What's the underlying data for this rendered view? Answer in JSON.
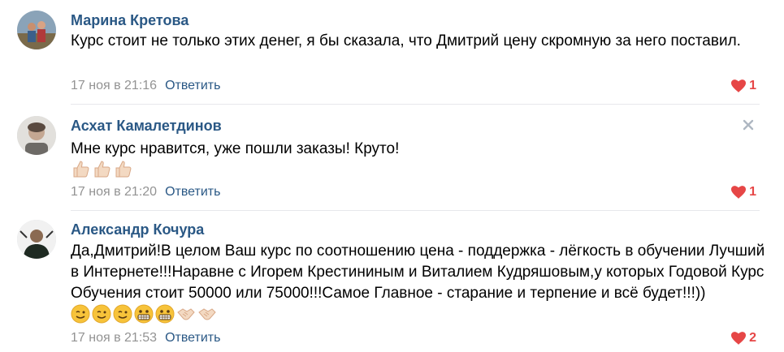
{
  "comments": [
    {
      "author": "Марина Кретова",
      "text": "Курс стоит не только этих денег, я бы сказала, что Дмитрий цену скромную за него поставил.",
      "date": "17 ноя в 21:16",
      "reply_label": "Ответить",
      "likes": "1",
      "avatar_icon": "user-photo",
      "emojis": []
    },
    {
      "author": "Асхат Камалетдинов",
      "text": "Мне курс нравится, уже пошли заказы! Круто!",
      "date": "17 ноя в 21:20",
      "reply_label": "Ответить",
      "likes": "1",
      "avatar_icon": "user-photo",
      "emojis": [
        "thumbs-up-light",
        "thumbs-up-light",
        "thumbs-up-light"
      ]
    },
    {
      "author": "Александр Кочура",
      "text": "Да,Дмитрий!В целом Ваш курс по соотношению цена - поддержка - лёгкость в обучении Лучший в Интернете!!!Наравне с Игорем Крестининым и Виталием Кудряшовым,у которых Годовой Курс Обучения стоит 50000 или 75000!!!Самое Главное - старание и терпение и всё будет!!!))",
      "date": "17 ноя в 21:53",
      "reply_label": "Ответить",
      "likes": "2",
      "avatar_icon": "user-photo",
      "emojis": [
        "winking-face",
        "winking-face",
        "winking-face",
        "grimacing-face",
        "grimacing-face",
        "handshake",
        "handshake"
      ]
    }
  ],
  "colors": {
    "author": "#2a5885",
    "meta": "#939393",
    "like": "#e64646",
    "divider": "#e7e8ec"
  }
}
